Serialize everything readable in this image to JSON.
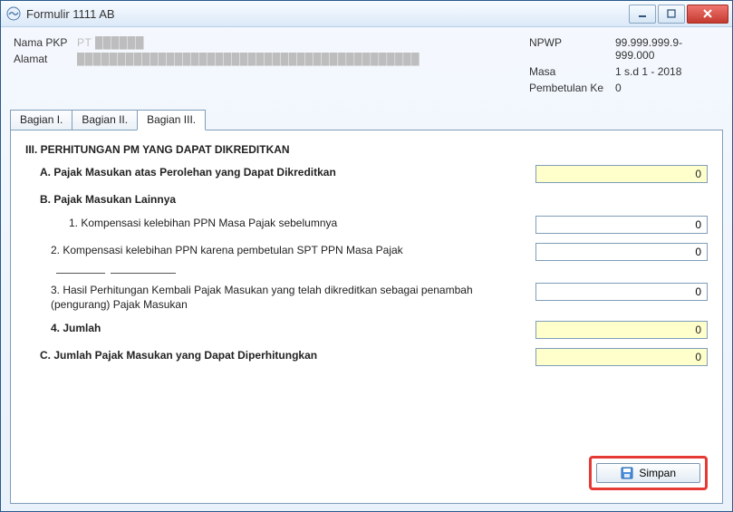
{
  "window": {
    "title": "Formulir 1111 AB"
  },
  "header": {
    "left": {
      "nama_label": "Nama PKP",
      "nama_value": "PT ██████",
      "alamat_label": "Alamat",
      "alamat_value": "██████████████████████████████████████████"
    },
    "right": {
      "npwp_label": "NPWP",
      "npwp_value": "99.999.999.9-999.000",
      "masa_label": "Masa",
      "masa_value": "1 s.d 1 - 2018",
      "pembetulan_label": "Pembetulan Ke",
      "pembetulan_value": "0"
    }
  },
  "tabs": {
    "t1": "Bagian I.",
    "t2": "Bagian II.",
    "t3": "Bagian III."
  },
  "section": {
    "title": "III. PERHITUNGAN PM YANG DAPAT DIKREDITKAN",
    "A_label": "A. Pajak Masukan atas Perolehan yang Dapat Dikreditkan",
    "A_value": "0",
    "B_label": "B. Pajak Masukan Lainnya",
    "B1_label": "1. Kompensasi kelebihan PPN Masa Pajak sebelumnya",
    "B1_value": "0",
    "B2_label": "2. Kompensasi kelebihan PPN karena pembetulan SPT PPN Masa Pajak",
    "B2_in1": "",
    "B2_in2": "",
    "B2_value": "0",
    "B3_label": "3. Hasil Perhitungan Kembali Pajak Masukan yang telah dikreditkan sebagai penambah (pengurang) Pajak Masukan",
    "B3_value": "0",
    "B4_label": "4. Jumlah",
    "B4_value": "0",
    "C_label": "C. Jumlah Pajak Masukan yang Dapat Diperhitungkan",
    "C_value": "0"
  },
  "buttons": {
    "save": "Simpan"
  }
}
